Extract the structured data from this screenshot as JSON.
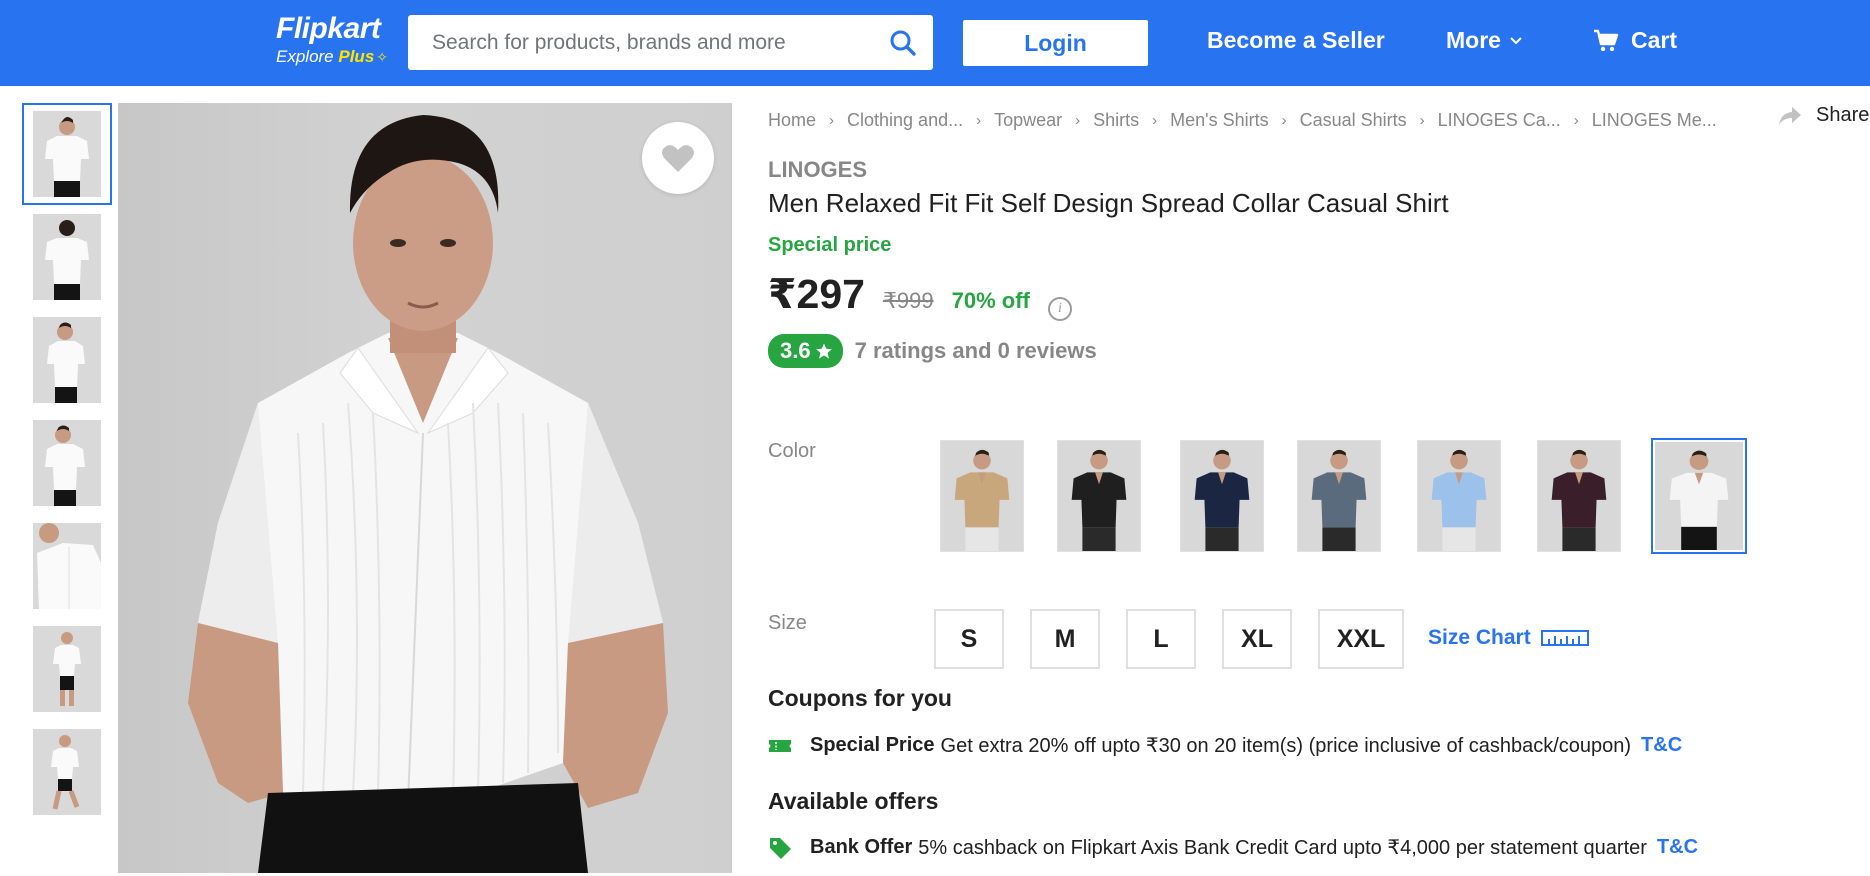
{
  "header": {
    "logo": "Flipkart",
    "logo_tagline": "Explore",
    "logo_plus": "Plus",
    "search_placeholder": "Search for products, brands and more",
    "login": "Login",
    "seller": "Become a Seller",
    "more": "More",
    "cart": "Cart"
  },
  "breadcrumb": [
    "Home",
    "Clothing and...",
    "Topwear",
    "Shirts",
    "Men's Shirts",
    "Casual Shirts",
    "LINOGES Ca...",
    "LINOGES Me..."
  ],
  "share": "Share",
  "product": {
    "brand": "LINOGES",
    "title": "Men Relaxed Fit Fit Self Design Spread Collar Casual Shirt",
    "special_label": "Special price",
    "price": "₹297",
    "mrp": "₹999",
    "discount": "70% off",
    "rating": "3.6",
    "rating_text": "7 ratings and 0 reviews"
  },
  "colors": {
    "label": "Color",
    "swatches": [
      "#c8a77c",
      "#1f1f1f",
      "#1a2642",
      "#5a6b7d",
      "#9cc1ea",
      "#3a1f2b",
      "#f4f4f4"
    ],
    "selected_index": 6
  },
  "sizes": {
    "label": "Size",
    "options": [
      "S",
      "M",
      "L",
      "XL",
      "XXL"
    ],
    "size_chart": "Size Chart"
  },
  "coupons": {
    "title": "Coupons for you",
    "label": "Special Price",
    "text": "Get extra 20% off upto ₹30 on 20 item(s) (price inclusive of cashback/coupon)",
    "tc": "T&C"
  },
  "offers": {
    "title": "Available offers",
    "label": "Bank Offer",
    "text": "5% cashback on Flipkart Axis Bank Credit Card upto ₹4,000 per statement quarter",
    "tc": "T&C"
  },
  "colors_theme": {
    "brand_blue": "#2874f0",
    "green": "#26a541"
  }
}
